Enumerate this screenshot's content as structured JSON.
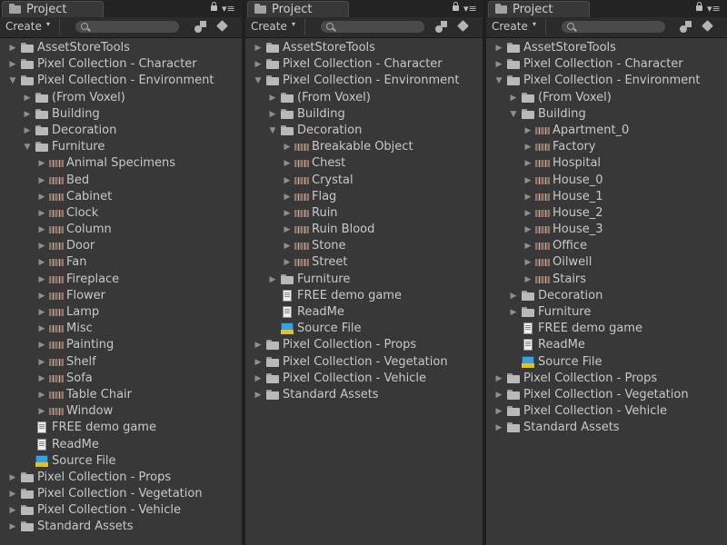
{
  "panel": {
    "title": "Project",
    "create_label": "Create",
    "create_caret": "▾",
    "menu_glyph": "▾≡"
  },
  "panels": [
    {
      "rows": [
        {
          "depth": 0,
          "arrow": "right",
          "icon": "folder-icon",
          "label": "AssetStoreTools"
        },
        {
          "depth": 0,
          "arrow": "right",
          "icon": "folder-icon",
          "label": "Pixel Collection - Character"
        },
        {
          "depth": 0,
          "arrow": "down",
          "icon": "folder-icon",
          "label": "Pixel Collection - Environment"
        },
        {
          "depth": 1,
          "arrow": "right",
          "icon": "folder-icon",
          "label": "(From Voxel)"
        },
        {
          "depth": 1,
          "arrow": "right",
          "icon": "folder-icon",
          "label": "Building"
        },
        {
          "depth": 1,
          "arrow": "right",
          "icon": "folder-icon",
          "label": "Decoration"
        },
        {
          "depth": 1,
          "arrow": "down",
          "icon": "folder-icon",
          "label": "Furniture"
        },
        {
          "depth": 2,
          "arrow": "right",
          "icon": "prefab-icon",
          "label": "Animal Specimens"
        },
        {
          "depth": 2,
          "arrow": "right",
          "icon": "prefab-icon",
          "label": "Bed"
        },
        {
          "depth": 2,
          "arrow": "right",
          "icon": "prefab-icon",
          "label": "Cabinet"
        },
        {
          "depth": 2,
          "arrow": "right",
          "icon": "prefab-icon",
          "label": "Clock"
        },
        {
          "depth": 2,
          "arrow": "right",
          "icon": "prefab-icon",
          "label": "Column"
        },
        {
          "depth": 2,
          "arrow": "right",
          "icon": "prefab-icon",
          "label": "Door"
        },
        {
          "depth": 2,
          "arrow": "right",
          "icon": "prefab-icon",
          "label": "Fan"
        },
        {
          "depth": 2,
          "arrow": "right",
          "icon": "prefab-icon",
          "label": "Fireplace"
        },
        {
          "depth": 2,
          "arrow": "right",
          "icon": "prefab-icon",
          "label": "Flower"
        },
        {
          "depth": 2,
          "arrow": "right",
          "icon": "prefab-icon",
          "label": "Lamp"
        },
        {
          "depth": 2,
          "arrow": "right",
          "icon": "prefab-icon",
          "label": "Misc"
        },
        {
          "depth": 2,
          "arrow": "right",
          "icon": "prefab-icon",
          "label": "Painting"
        },
        {
          "depth": 2,
          "arrow": "right",
          "icon": "prefab-icon",
          "label": "Shelf"
        },
        {
          "depth": 2,
          "arrow": "right",
          "icon": "prefab-icon",
          "label": "Sofa"
        },
        {
          "depth": 2,
          "arrow": "right",
          "icon": "prefab-icon",
          "label": "Table Chair"
        },
        {
          "depth": 2,
          "arrow": "right",
          "icon": "prefab-icon",
          "label": "Window"
        },
        {
          "depth": 1,
          "arrow": "none",
          "icon": "doc-icon",
          "label": "FREE demo game"
        },
        {
          "depth": 1,
          "arrow": "none",
          "icon": "doc-icon",
          "label": "ReadMe"
        },
        {
          "depth": 1,
          "arrow": "none",
          "icon": "package-icon",
          "label": "Source File"
        },
        {
          "depth": 0,
          "arrow": "right",
          "icon": "folder-icon",
          "label": "Pixel Collection - Props"
        },
        {
          "depth": 0,
          "arrow": "right",
          "icon": "folder-icon",
          "label": "Pixel Collection - Vegetation"
        },
        {
          "depth": 0,
          "arrow": "right",
          "icon": "folder-icon",
          "label": "Pixel Collection - Vehicle"
        },
        {
          "depth": 0,
          "arrow": "right",
          "icon": "folder-icon",
          "label": "Standard Assets"
        }
      ]
    },
    {
      "rows": [
        {
          "depth": 0,
          "arrow": "right",
          "icon": "folder-icon",
          "label": "AssetStoreTools"
        },
        {
          "depth": 0,
          "arrow": "right",
          "icon": "folder-icon",
          "label": "Pixel Collection - Character"
        },
        {
          "depth": 0,
          "arrow": "down",
          "icon": "folder-icon",
          "label": "Pixel Collection - Environment"
        },
        {
          "depth": 1,
          "arrow": "right",
          "icon": "folder-icon",
          "label": "(From Voxel)"
        },
        {
          "depth": 1,
          "arrow": "right",
          "icon": "folder-icon",
          "label": "Building"
        },
        {
          "depth": 1,
          "arrow": "down",
          "icon": "folder-icon",
          "label": "Decoration"
        },
        {
          "depth": 2,
          "arrow": "right",
          "icon": "prefab-icon",
          "label": "Breakable Object"
        },
        {
          "depth": 2,
          "arrow": "right",
          "icon": "prefab-icon",
          "label": "Chest"
        },
        {
          "depth": 2,
          "arrow": "right",
          "icon": "prefab-icon",
          "label": "Crystal"
        },
        {
          "depth": 2,
          "arrow": "right",
          "icon": "prefab-icon",
          "label": "Flag"
        },
        {
          "depth": 2,
          "arrow": "right",
          "icon": "prefab-icon",
          "label": "Ruin"
        },
        {
          "depth": 2,
          "arrow": "right",
          "icon": "prefab-icon",
          "label": "Ruin Blood"
        },
        {
          "depth": 2,
          "arrow": "right",
          "icon": "prefab-icon",
          "label": "Stone"
        },
        {
          "depth": 2,
          "arrow": "right",
          "icon": "prefab-icon",
          "label": "Street"
        },
        {
          "depth": 1,
          "arrow": "right",
          "icon": "folder-icon",
          "label": "Furniture"
        },
        {
          "depth": 1,
          "arrow": "none",
          "icon": "doc-icon",
          "label": "FREE demo game"
        },
        {
          "depth": 1,
          "arrow": "none",
          "icon": "doc-icon",
          "label": "ReadMe"
        },
        {
          "depth": 1,
          "arrow": "none",
          "icon": "package-icon",
          "label": "Source File"
        },
        {
          "depth": 0,
          "arrow": "right",
          "icon": "folder-icon",
          "label": "Pixel Collection - Props"
        },
        {
          "depth": 0,
          "arrow": "right",
          "icon": "folder-icon",
          "label": "Pixel Collection - Vegetation"
        },
        {
          "depth": 0,
          "arrow": "right",
          "icon": "folder-icon",
          "label": "Pixel Collection - Vehicle"
        },
        {
          "depth": 0,
          "arrow": "right",
          "icon": "folder-icon",
          "label": "Standard Assets"
        }
      ]
    },
    {
      "rows": [
        {
          "depth": 0,
          "arrow": "right",
          "icon": "folder-icon",
          "label": "AssetStoreTools"
        },
        {
          "depth": 0,
          "arrow": "right",
          "icon": "folder-icon",
          "label": "Pixel Collection - Character"
        },
        {
          "depth": 0,
          "arrow": "down",
          "icon": "folder-icon",
          "label": "Pixel Collection - Environment"
        },
        {
          "depth": 1,
          "arrow": "right",
          "icon": "folder-icon",
          "label": "(From Voxel)"
        },
        {
          "depth": 1,
          "arrow": "down",
          "icon": "folder-icon",
          "label": "Building"
        },
        {
          "depth": 2,
          "arrow": "right",
          "icon": "prefab-icon",
          "label": "Apartment_0"
        },
        {
          "depth": 2,
          "arrow": "right",
          "icon": "prefab-icon",
          "label": "Factory"
        },
        {
          "depth": 2,
          "arrow": "right",
          "icon": "prefab-icon",
          "label": "Hospital"
        },
        {
          "depth": 2,
          "arrow": "right",
          "icon": "prefab-icon",
          "label": "House_0"
        },
        {
          "depth": 2,
          "arrow": "right",
          "icon": "prefab-icon",
          "label": "House_1"
        },
        {
          "depth": 2,
          "arrow": "right",
          "icon": "prefab-icon",
          "label": "House_2"
        },
        {
          "depth": 2,
          "arrow": "right",
          "icon": "prefab-icon",
          "label": "House_3"
        },
        {
          "depth": 2,
          "arrow": "right",
          "icon": "prefab-icon",
          "label": "Office"
        },
        {
          "depth": 2,
          "arrow": "right",
          "icon": "prefab-icon",
          "label": "Oilwell"
        },
        {
          "depth": 2,
          "arrow": "right",
          "icon": "prefab-icon",
          "label": "Stairs"
        },
        {
          "depth": 1,
          "arrow": "right",
          "icon": "folder-icon",
          "label": "Decoration"
        },
        {
          "depth": 1,
          "arrow": "right",
          "icon": "folder-icon",
          "label": "Furniture"
        },
        {
          "depth": 1,
          "arrow": "none",
          "icon": "doc-icon",
          "label": "FREE demo game"
        },
        {
          "depth": 1,
          "arrow": "none",
          "icon": "doc-icon",
          "label": "ReadMe"
        },
        {
          "depth": 1,
          "arrow": "none",
          "icon": "package-icon",
          "label": "Source File"
        },
        {
          "depth": 0,
          "arrow": "right",
          "icon": "folder-icon",
          "label": "Pixel Collection - Props"
        },
        {
          "depth": 0,
          "arrow": "right",
          "icon": "folder-icon",
          "label": "Pixel Collection - Vegetation"
        },
        {
          "depth": 0,
          "arrow": "right",
          "icon": "folder-icon",
          "label": "Pixel Collection - Vehicle"
        },
        {
          "depth": 0,
          "arrow": "right",
          "icon": "folder-icon",
          "label": "Standard Assets"
        }
      ]
    }
  ]
}
